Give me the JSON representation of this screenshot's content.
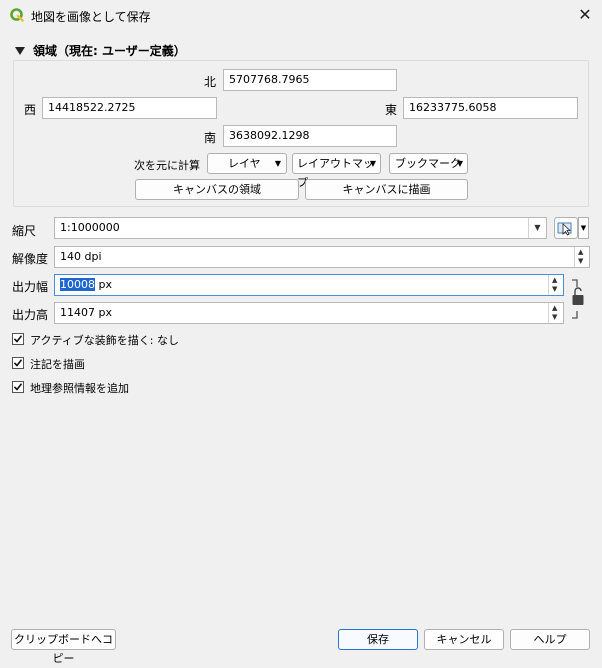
{
  "window": {
    "title": "地図を画像として保存",
    "close_glyph": "✕"
  },
  "extent": {
    "section_title": "領域（現在: ユーザー定義）",
    "north_label": "北",
    "north_value": "5707768.7965",
    "west_label": "西",
    "west_value": "14418522.2725",
    "east_label": "東",
    "east_value": "16233775.6058",
    "south_label": "南",
    "south_value": "3638092.1298",
    "calc_from_label": "次を元に計算",
    "layer_combo": "レイヤ",
    "layout_map_combo": "レイアウトマップ",
    "bookmark_combo": "ブックマーク",
    "canvas_extent_button": "キャンバスの領域",
    "draw_on_canvas_button": "キャンバスに描画"
  },
  "scale": {
    "label": "縮尺",
    "value": "1:1000000"
  },
  "resolution": {
    "label": "解像度",
    "value": "140 dpi"
  },
  "output_width": {
    "label": "出力幅",
    "value_selected": "10008",
    "unit": " px"
  },
  "output_height": {
    "label": "出力高",
    "value": "11407 px"
  },
  "options": {
    "active_decorations": "アクティブな装飾を描く: なし",
    "draw_annotations": "注記を描画",
    "append_georef": "地理参照情報を追加"
  },
  "footer": {
    "copy_clipboard": "クリップボードへコピー",
    "save": "保存",
    "cancel": "キャンセル",
    "help": "ヘルプ"
  },
  "colors": {
    "accent": "#1e66d0",
    "qgis_green": "#5ba530"
  }
}
